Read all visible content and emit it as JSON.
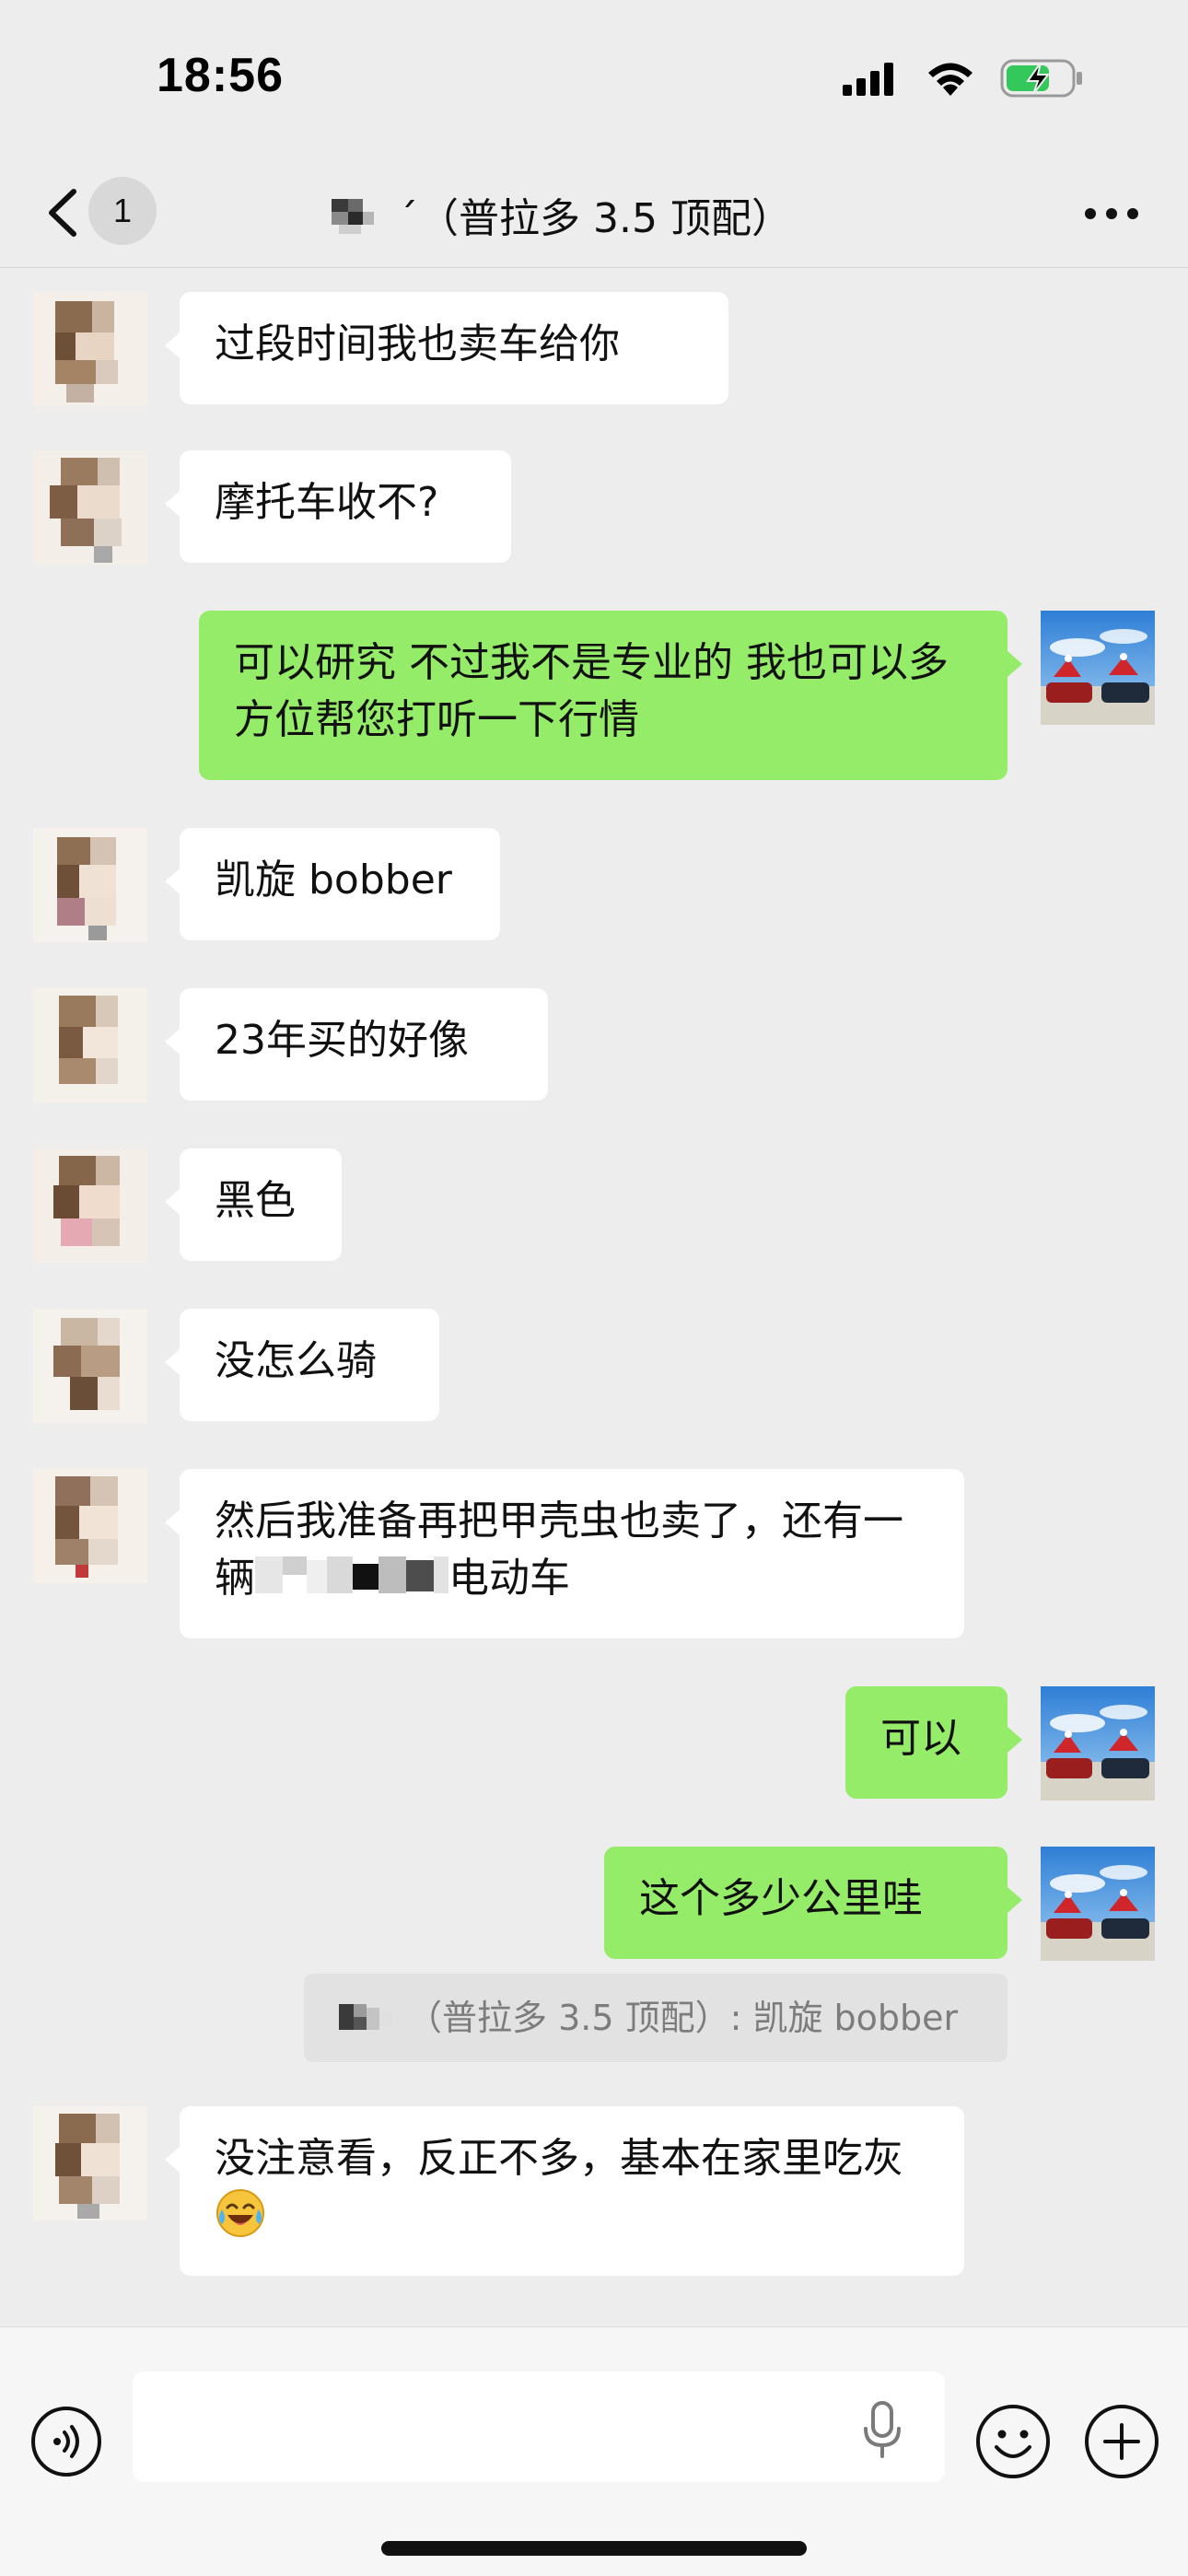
{
  "status_bar": {
    "time": "18:56"
  },
  "header": {
    "unread_count": "1",
    "title": "ˊ（普拉多 3.5 顶配）"
  },
  "messages": [
    {
      "side": "in",
      "text": "过段时间我也卖车给你"
    },
    {
      "side": "in",
      "text": "摩托车收不?"
    },
    {
      "side": "out",
      "text": "可以研究 不过我不是专业的 我也可以多方位帮您打听一下行情"
    },
    {
      "side": "in",
      "text": "凯旋 bobber"
    },
    {
      "side": "in",
      "text": "23年买的好像"
    },
    {
      "side": "in",
      "text": "黑色"
    },
    {
      "side": "in",
      "text": "没怎么骑"
    },
    {
      "side": "in",
      "text_before": "然后我准备再把甲壳虫也卖了，还有一辆",
      "text_after": "电动车"
    },
    {
      "side": "out",
      "text": "可以"
    },
    {
      "side": "out",
      "text": "这个多少公里哇"
    },
    {
      "side": "in",
      "text": "没注意看，反正不多，基本在家里吃灰"
    }
  ],
  "quote": {
    "text": "（普拉多 3.5 顶配）: 凯旋 bobber"
  },
  "input": {
    "value": ""
  },
  "icons": {
    "back": "chevron-left-icon",
    "more": "more-dots-icon",
    "voice": "voice-icon",
    "mic": "microphone-icon",
    "emoji": "emoji-icon",
    "plus": "plus-icon",
    "laugh_cry": "laughing-crying-emoji"
  },
  "colors": {
    "background": "#ededed",
    "out_bubble": "#95ec69",
    "in_bubble": "#ffffff"
  }
}
